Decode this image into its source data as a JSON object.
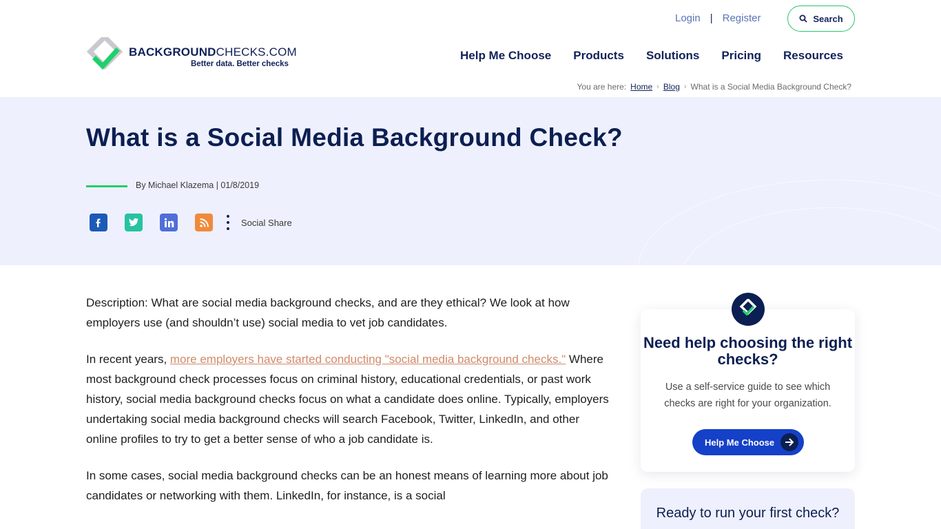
{
  "logo": {
    "brand_bold": "BACKGROUND",
    "brand_light": "CHECKS.COM",
    "tag_part1": "Better data.",
    "tag_part2": "Better checks"
  },
  "top_links": {
    "login": "Login",
    "separator": "|",
    "register": "Register",
    "search": "Search"
  },
  "nav": [
    "Help Me Choose",
    "Products",
    "Solutions",
    "Pricing",
    "Resources"
  ],
  "breadcrumb": {
    "prefix": "You are here:",
    "home": "Home",
    "blog": "Blog",
    "current": "What is a Social Media Background Check?"
  },
  "hero": {
    "title": "What is a Social Media Background Check?",
    "byline": "By Michael Klazema | 01/8/2019",
    "share_label": "Social Share"
  },
  "share_icons": [
    {
      "name": "facebook-icon",
      "glyph": "f"
    },
    {
      "name": "twitter-icon",
      "glyph": "t"
    },
    {
      "name": "linkedin-icon",
      "glyph": "in"
    },
    {
      "name": "rss-icon",
      "glyph": "●"
    }
  ],
  "article": {
    "p1": "Description: What are social media background checks, and are they ethical? We look at how employers use (and shouldn’t use) social media to vet job candidates.",
    "p2_before": "In recent years, ",
    "p2_link": "more employers have started conducting \"social media background checks.\"",
    "p2_after": " Where most background check processes focus on criminal history, educational credentials, or past work history, social media background checks focus on what a candidate does online. Typically, employers undertaking social media background checks will search Facebook, Twitter, LinkedIn, and other online profiles to try to get a better sense of who a job candidate is.",
    "p3": "In some cases, social media background checks can be an honest means of learning more about job candidates or networking with them. LinkedIn, for instance, is a social"
  },
  "sidebar": {
    "title": "Need help choosing the right checks?",
    "text": "Use a self-service guide to see which checks are right for your organization.",
    "cta": "Help Me Choose",
    "card2_title": "Ready to run your first check?"
  },
  "colors": {
    "navy": "#0c1f52",
    "green": "#1fd06c",
    "blue": "#1540c8",
    "hero_bg": "#eef0fd"
  }
}
